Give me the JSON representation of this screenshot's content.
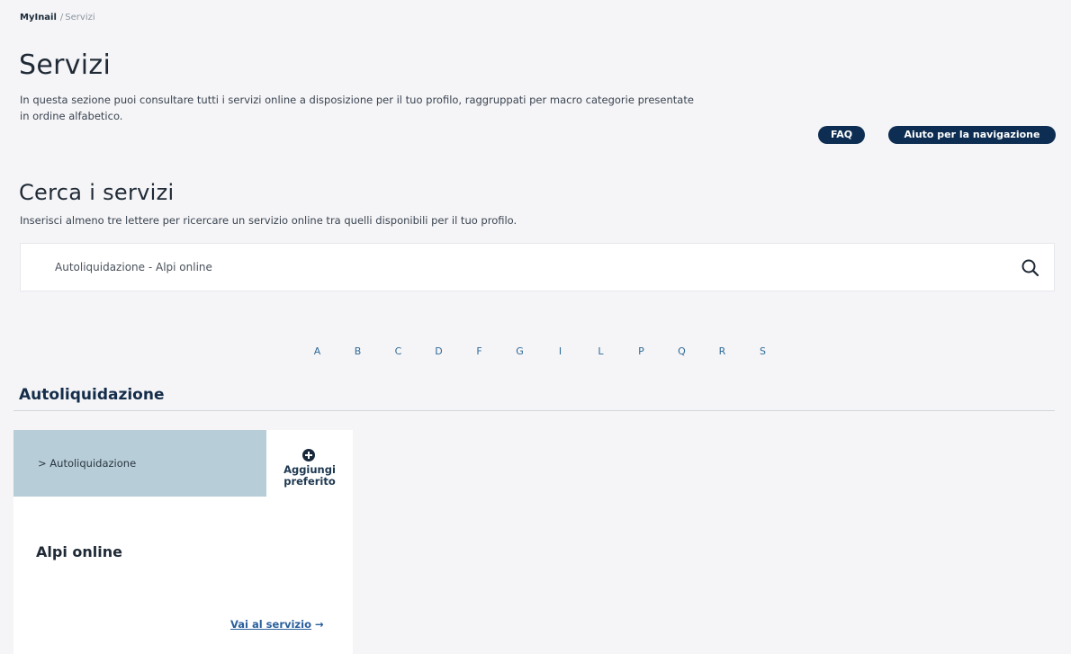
{
  "breadcrumb": {
    "home": "MyInail",
    "separator": "/",
    "current": "Servizi"
  },
  "page": {
    "title": "Servizi",
    "description": "In questa sezione puoi consultare tutti i servizi online a disposizione per il tuo profilo, raggruppati per macro categorie presentate in ordine alfabetico."
  },
  "actions": {
    "faq_label": "FAQ",
    "help_label": "Aiuto per la navigazione"
  },
  "search": {
    "title": "Cerca i servizi",
    "description": "Inserisci almeno tre lettere per ricercare un servizio online tra quelli disponibili per il tuo profilo.",
    "value": "Autoliquidazione - Alpi online",
    "icon": "search-icon"
  },
  "alphabet": [
    "A",
    "B",
    "C",
    "D",
    "F",
    "G",
    "I",
    "L",
    "P",
    "Q",
    "R",
    "S"
  ],
  "category": {
    "title": "Autoliquidazione",
    "card": {
      "tag": "> Autoliquidazione",
      "favorite_icon": "plus-circle-icon",
      "favorite_label": "Aggiungi preferito",
      "title": "Alpi online",
      "link_label": "Vai al servizio",
      "link_arrow": "→"
    }
  },
  "colors": {
    "background": "#f5f5f7",
    "primary_dark": "#0d2e52",
    "tag_background": "#b7cdd7",
    "link": "#2a5f9c"
  }
}
